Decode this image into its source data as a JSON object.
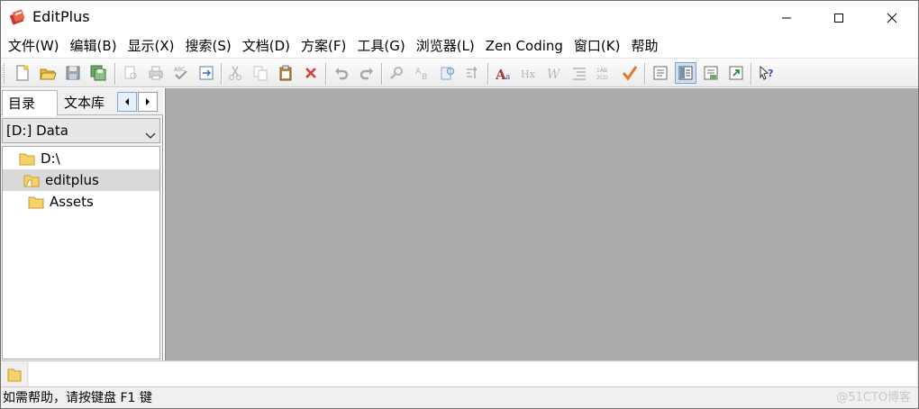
{
  "window": {
    "title": "EditPlus"
  },
  "menu": [
    {
      "label": "文件(W)"
    },
    {
      "label": "编辑(B)"
    },
    {
      "label": "显示(X)"
    },
    {
      "label": "搜索(S)"
    },
    {
      "label": "文档(D)"
    },
    {
      "label": "方案(F)"
    },
    {
      "label": "工具(G)"
    },
    {
      "label": "浏览器(L)"
    },
    {
      "label": "Zen Coding"
    },
    {
      "label": "窗口(K)"
    },
    {
      "label": "帮助"
    }
  ],
  "toolbar_icons": [
    "new-file-icon",
    "open-file-icon",
    "save-icon",
    "save-all-icon",
    "print-preview-icon",
    "print-icon",
    "spellcheck-icon",
    "browser-preview-icon",
    "cut-icon",
    "copy-icon",
    "paste-icon",
    "delete-icon",
    "undo-icon",
    "redo-icon",
    "find-icon",
    "replace-icon",
    "find-in-files-icon",
    "goto-icon",
    "font-icon",
    "hex-icon",
    "word-wrap-icon",
    "indent-icon",
    "line-number-icon",
    "check-icon",
    "document-icon",
    "directory-window-icon",
    "cliptext-icon",
    "output-window-icon",
    "help-icon"
  ],
  "left_panel": {
    "tabs": [
      {
        "label": "目录"
      },
      {
        "label": "文本库"
      }
    ],
    "drive": "[D:] Data",
    "tree": [
      {
        "label": "D:\\",
        "depth": 0,
        "selected": false
      },
      {
        "label": "editplus",
        "depth": 1,
        "selected": true
      },
      {
        "label": "Assets",
        "depth": 2,
        "selected": false
      }
    ]
  },
  "status": {
    "text": "如需帮助，请按键盘 F1 键",
    "watermark": "@51CTO博客"
  },
  "colors": {
    "editor_bg": "#ababab",
    "folder": "#f5d36b",
    "selected_row": "#d9d9d9"
  }
}
